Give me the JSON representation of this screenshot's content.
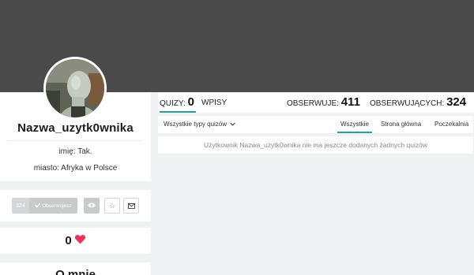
{
  "profile": {
    "username": "Nazwa_uzytk0wnika",
    "info": [
      {
        "label": "imię:",
        "value": "Tak."
      },
      {
        "label": "miasto:",
        "value": "Afryka w Polsce"
      }
    ]
  },
  "actions": {
    "observers_count": "324",
    "observe_label": "Obserwujesz",
    "icons": [
      "check-icon",
      "eye-icon",
      "star-icon",
      "mail-icon"
    ]
  },
  "likes": {
    "count": "0",
    "icon": "heart-icon",
    "color": "#f0325a"
  },
  "about": {
    "title": "O mnie"
  },
  "stats": {
    "quizy_label": "QUIZY:",
    "quizy_count": "0",
    "wpisy_label": "WPISY",
    "obserwuje_label": "OBSERWUJE:",
    "obserwuje_count": "411",
    "obserwujacych_label": "OBSERWUJĄCYCH:",
    "obserwujacych_count": "324"
  },
  "filters": {
    "type_select": "Wszystkie typy quizów",
    "tabs": [
      "Wszystkie",
      "Strona główna",
      "Poczekalnia"
    ],
    "active_tab": "Wszystkie"
  },
  "empty_message": "Użytkownik Nazwa_uzytk0wnika nie ma jeszcze dodanych żadnych quizów",
  "colors": {
    "accent": "#1aa5a5",
    "cover": "#4a4a4a",
    "background": "#eff1f2"
  }
}
